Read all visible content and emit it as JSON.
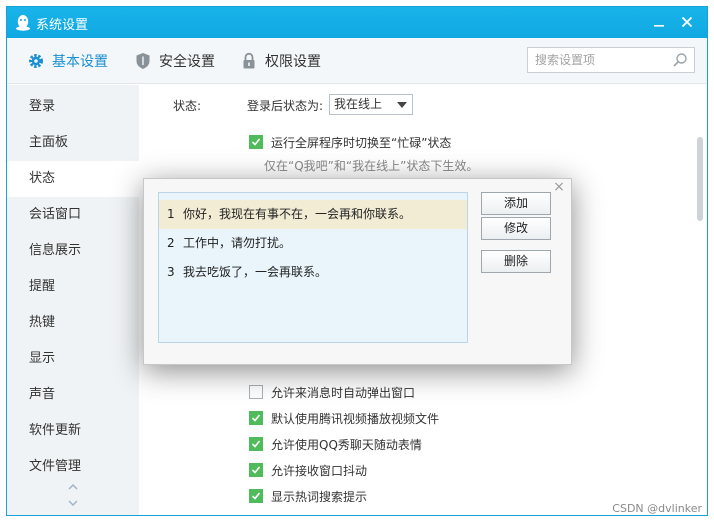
{
  "window": {
    "title": "系统设置",
    "minimize_icon": "minimize-icon",
    "close_icon": "close-icon"
  },
  "tabs": [
    {
      "label": "基本设置",
      "icon": "gear-icon",
      "active": true
    },
    {
      "label": "安全设置",
      "icon": "shield-icon",
      "active": false
    },
    {
      "label": "权限设置",
      "icon": "lock-icon",
      "active": false
    }
  ],
  "search": {
    "placeholder": "搜索设置项"
  },
  "sidebar": {
    "items": [
      {
        "label": "登录"
      },
      {
        "label": "主面板"
      },
      {
        "label": "状态",
        "active": true
      },
      {
        "label": "会话窗口"
      },
      {
        "label": "信息展示"
      },
      {
        "label": "提醒"
      },
      {
        "label": "热键"
      },
      {
        "label": "显示"
      },
      {
        "label": "声音"
      },
      {
        "label": "软件更新"
      },
      {
        "label": "文件管理"
      }
    ]
  },
  "status": {
    "label": "状态:",
    "after_login_label": "登录后状态为:",
    "after_login_value": "我在线上",
    "fullscreen_option": "运行全屏程序时切换至“忙碌”状态",
    "fullscreen_note": "仅在“Q我吧”和“我在线上”状态下生效。"
  },
  "options": [
    {
      "label": "允许来消息时自动弹出窗口",
      "checked": false
    },
    {
      "label": "默认使用腾讯视频播放视频文件",
      "checked": true
    },
    {
      "label": "允许使用QQ秀聊天随动表情",
      "checked": true
    },
    {
      "label": "允许接收窗口抖动",
      "checked": true
    },
    {
      "label": "显示热词搜索提示",
      "checked": true
    }
  ],
  "dialog": {
    "replies": [
      {
        "num": "1",
        "text": "你好，我现在有事不在，一会再和你联系。",
        "selected": true
      },
      {
        "num": "2",
        "text": "工作中，请勿打扰。",
        "selected": false
      },
      {
        "num": "3",
        "text": "我去吃饭了，一会再联系。",
        "selected": false
      }
    ],
    "add_label": "添加",
    "edit_label": "修改",
    "delete_label": "删除",
    "close_label": "×"
  },
  "watermark": "CSDN @dvlinker",
  "colors": {
    "titlebar": "#12b7f5",
    "accent": "#1a8fd1",
    "checkbox": "#4fbb5a"
  }
}
